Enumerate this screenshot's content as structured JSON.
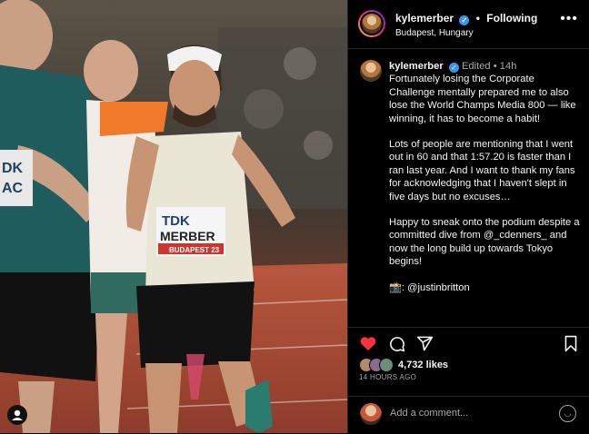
{
  "post": {
    "username": "kylemerber",
    "follow_label": "Following",
    "location": "Budapest, Hungary",
    "more_label": "•••"
  },
  "caption": {
    "username": "kylemerber",
    "meta": "Edited • 14h",
    "paragraphs": [
      "Fortunately losing the Corporate Challenge mentally prepared me to also lose the World Champs Media 800 — like winning, it has to become a habit!",
      "Lots of people are mentioning that I went out in 60 and that 1:57.20 is faster than I ran last year. And I want to thank my fans for acknowledging that I haven't slept in five days but no excuses…",
      "Happy to sneak onto the podium despite a committed dive from @_cdenners_ and now the long build up towards Tokyo begins!",
      "📸: @justinbritton"
    ]
  },
  "photo": {
    "bib_name": "MERBER",
    "bib_brand": "TDK",
    "bib_event": "BUDAPEST 23"
  },
  "engagement": {
    "likes": "4,732 likes",
    "time": "14 HOURS AGO"
  },
  "comment": {
    "placeholder": "Add a comment..."
  },
  "colors": {
    "background": "#000000",
    "divider": "#262626",
    "like_red": "#ff3040",
    "muted": "#a8a8a8",
    "verified": "#3897f0"
  }
}
